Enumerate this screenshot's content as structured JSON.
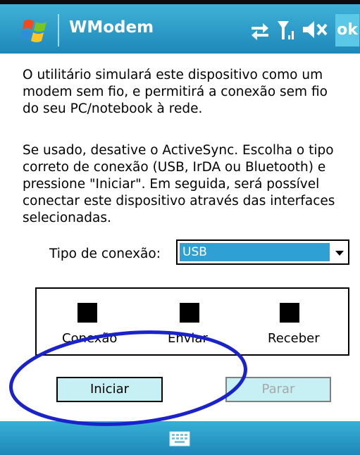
{
  "titlebar": {
    "app_title": "WModem",
    "icons": [
      "windows-logo-icon",
      "connectivity-icon",
      "signal-icon",
      "volume-muted-icon"
    ],
    "ok_label": "ok"
  },
  "content": {
    "paragraph1": "O utilitário simulará este dispositivo como um modem sem fio, e permitirá a conexão sem fio do seu PC/notebook à rede.",
    "paragraph2": "Se usado, desative o ActiveSync. Escolha o tipo correto de conexão (USB, IrDA ou Bluetooth) e pressione  \"Iniciar\". Em seguida, será possível conectar este dispositivo através das interfaces selecionadas.",
    "connection_label": "Tipo de conexão:",
    "connection_value": "USB"
  },
  "status": {
    "items": [
      {
        "label": "Conexão"
      },
      {
        "label": "Enviar"
      },
      {
        "label": "Receber"
      }
    ]
  },
  "buttons": {
    "start_label": "Iniciar",
    "stop_label": "Parar"
  },
  "bottombar": {
    "icon": "keyboard-icon"
  },
  "colors": {
    "titlebar": "#1e87b9",
    "selection": "#2fa0d3",
    "button_bg": "#c6f0f4",
    "annotation": "#1a23c9"
  }
}
